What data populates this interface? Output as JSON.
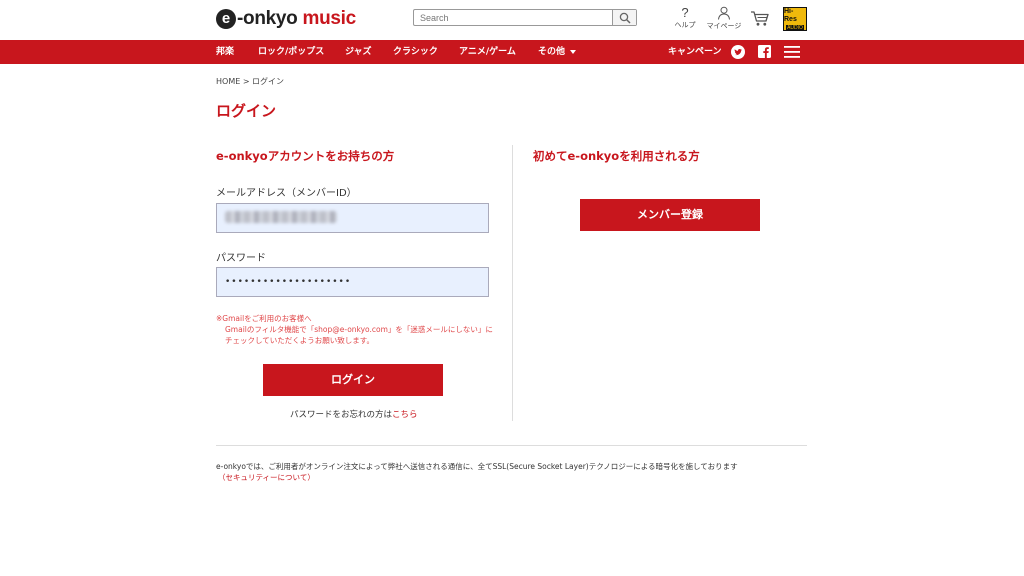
{
  "brand": {
    "logo_letter": "e",
    "logo_text": "-onkyo",
    "logo_music": "music"
  },
  "header": {
    "search_placeholder": "Search",
    "help_glyph": "?",
    "help_label": "ヘルプ",
    "mypage_label": "マイページ",
    "hires_line1": "Hi-Res",
    "hires_line2": "AUDIO"
  },
  "nav": {
    "items": [
      "邦楽",
      "ロック/ポップス",
      "ジャズ",
      "クラシック",
      "アニメ/ゲーム",
      "その他"
    ],
    "campaign": "キャンペーン"
  },
  "breadcrumb": "HOME > ログイン",
  "page_title": "ログイン",
  "login": {
    "heading": "e-onkyoアカウントをお持ちの方",
    "email_label": "メールアドレス（メンバーID）",
    "password_label": "パスワード",
    "password_value": "••••••••••••••••••••",
    "note_line1": "※Gmailをご利用のお客様へ",
    "note_line2": "Gmailのフィルタ機能で「shop@e-onkyo.com」を「迷惑メールにしない」に",
    "note_line3": "チェックしていただくようお願い致します。",
    "login_button": "ログイン",
    "forgot_text": "パスワードをお忘れの方は",
    "forgot_link": "こちら"
  },
  "register": {
    "heading": "初めてe-onkyoを利用される方",
    "member_button": "メンバー登録"
  },
  "footer": {
    "ssl_text": "e-onkyoでは、ご利用者がオンライン注文によって弊社へ送信される通信に、全てSSL(Secure Socket Layer)テクノロジーによる暗号化を施しております",
    "security_link": "（セキュリティーについて）"
  },
  "colors": {
    "brand_red": "#c8161d",
    "note_red": "#e0484a",
    "autofill_bg": "#e8f0fe"
  }
}
